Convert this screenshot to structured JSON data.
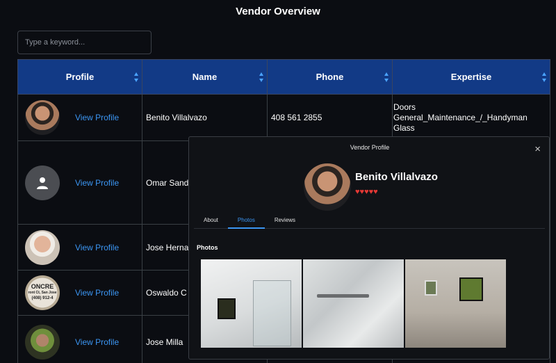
{
  "page": {
    "title": "Vendor Overview"
  },
  "search": {
    "placeholder": "Type a keyword..."
  },
  "table": {
    "headers": [
      "Profile",
      "Name",
      "Phone",
      "Expertise"
    ],
    "rows": [
      {
        "link": "View Profile",
        "name": "Benito Villalvazo",
        "phone": "408 561 2855",
        "expertise": [
          "Doors",
          "General_Maintenance_/_Handyman",
          "Glass"
        ]
      },
      {
        "link": "View Profile",
        "name": "Omar Sand",
        "phone": "",
        "expertise": []
      },
      {
        "link": "View Profile",
        "name": "Jose Herna",
        "phone": "",
        "expertise": []
      },
      {
        "link": "View Profile",
        "name": "Oswaldo C",
        "phone": "",
        "expertise": []
      },
      {
        "link": "View Profile",
        "name": "Jose Milla",
        "phone": "",
        "expertise": []
      }
    ],
    "avatar_text": [
      "ONCRE",
      "ront Ct, San Jose",
      "(408) 912-4"
    ]
  },
  "modal": {
    "title": "Vendor Profile",
    "close": "×",
    "name": "Benito Villalvazo",
    "hearts": "♥♥♥♥♥",
    "rating": 5,
    "tabs": [
      "About",
      "Photos",
      "Reviews"
    ],
    "active_tab": "Photos",
    "section_title": "Photos"
  },
  "colors": {
    "header_bg": "#123a86",
    "link": "#3b95f2",
    "heart": "#e53935",
    "bg": "#0b0d12"
  }
}
